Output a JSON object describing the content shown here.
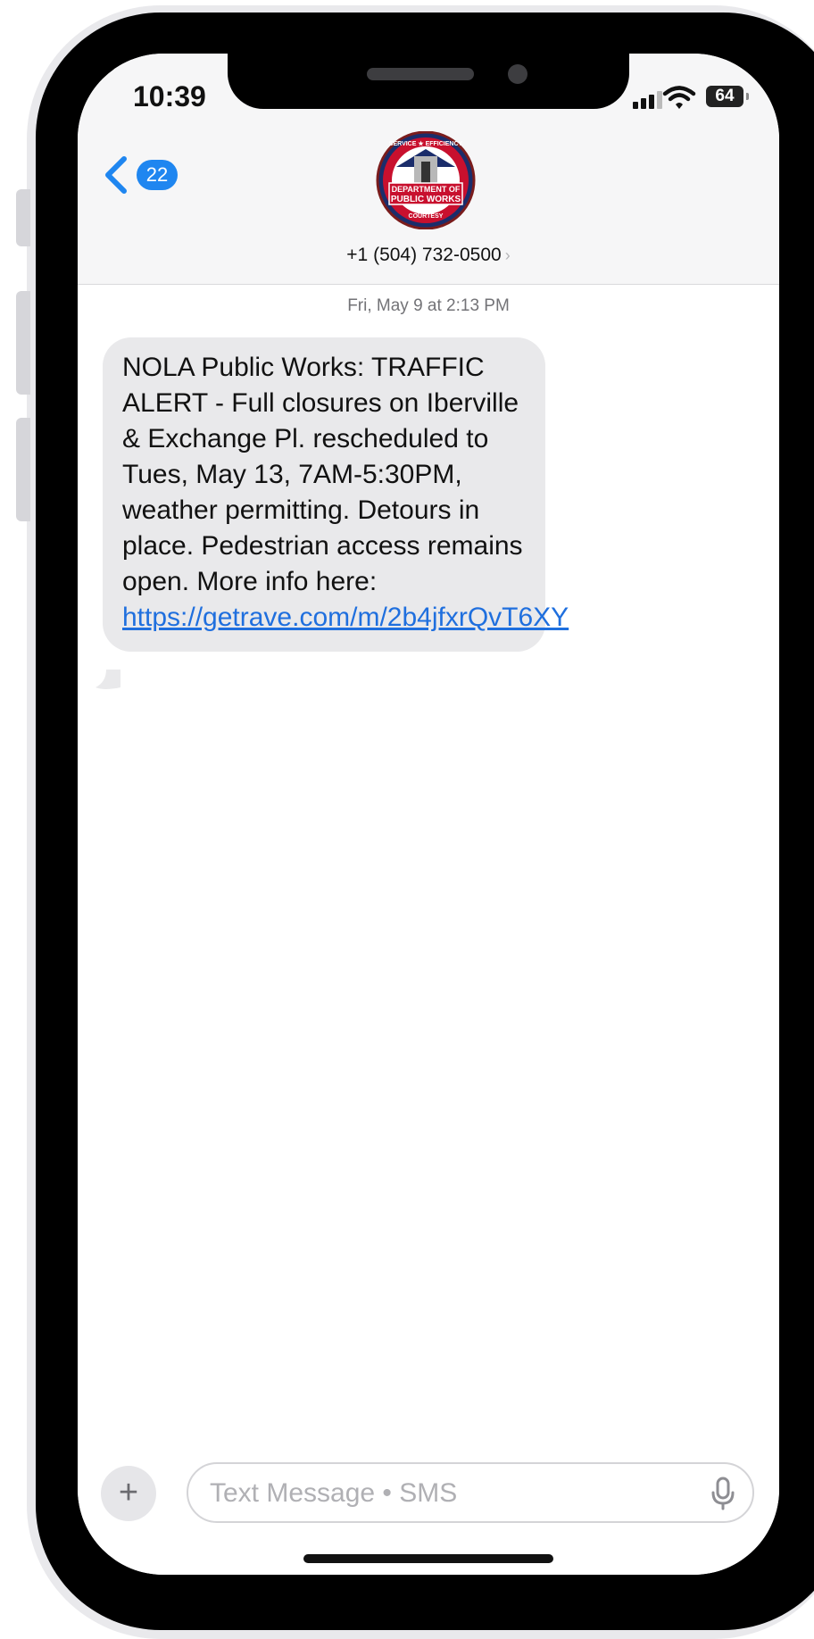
{
  "status_bar": {
    "time": "10:39",
    "battery": "64"
  },
  "header": {
    "unread_count": "22",
    "contact_number": "+1 (504) 732-0500",
    "contact_chevron": "›",
    "logo_text": {
      "top": "SERVICE ★ EFFICIENCY",
      "middle_1": "DEPARTMENT OF",
      "middle_2": "PUBLIC WORKS",
      "bottom": "COURTESY"
    }
  },
  "conversation": {
    "timestamp": "Fri, May 9 at 2:13 PM",
    "messages": [
      {
        "text": "NOLA Public Works: TRAFFIC ALERT - Full closures on Iberville & Exchange Pl. rescheduled to Tues, May 13, 7AM-5:30PM, weather permitting. Detours in place. Pedestrian access remains open. More info here: ",
        "link": "https://getrave.com/m/2b4jfxrQvT6XY"
      }
    ]
  },
  "composer": {
    "plus_label": "+",
    "placeholder": "Text Message • SMS"
  },
  "icons": {
    "back": "chevron-left-icon",
    "mic": "microphone-icon",
    "wifi": "wifi-icon",
    "signal": "signal-bars-icon"
  },
  "colors": {
    "accent_blue": "#1f86f0",
    "bubble_gray": "#e9e9eb",
    "link_blue": "#1f6fde"
  }
}
